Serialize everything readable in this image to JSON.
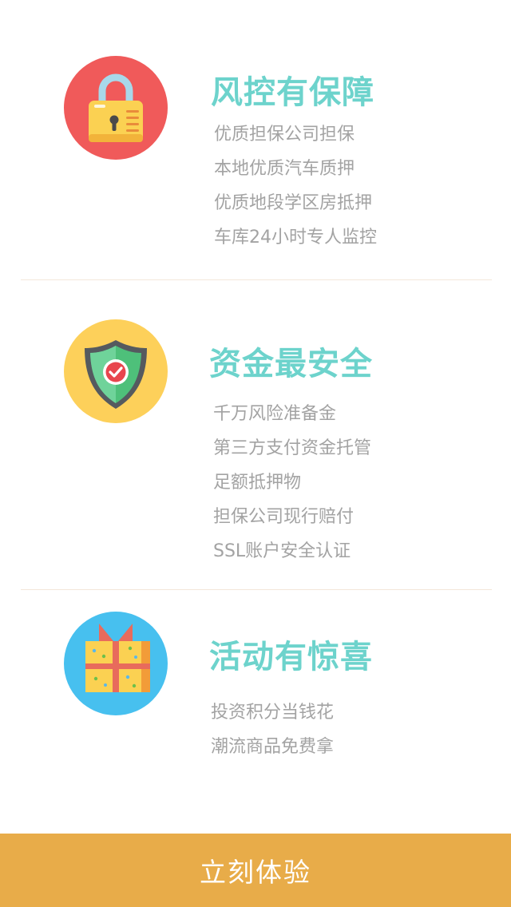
{
  "colors": {
    "title": "#6dd3cc",
    "item_text": "#a3a3a3",
    "divider": "#f3e7da",
    "cta_bg": "#e8ac49",
    "cta_text": "#ffffff"
  },
  "sections": [
    {
      "icon": "padlock-icon",
      "circle_color": "#f05a5a",
      "title": "风控有保障",
      "items": [
        "优质担保公司担保",
        "本地优质汽车质押",
        "优质地段学区房抵押",
        "车库24小时专人监控"
      ]
    },
    {
      "icon": "shield-check-icon",
      "circle_color": "#fdd05a",
      "title": "资金最安全",
      "items": [
        "千万风险准备金",
        "第三方支付资金托管",
        "足额抵押物",
        "担保公司现行赔付",
        "SSL账户安全认证"
      ]
    },
    {
      "icon": "gift-box-icon",
      "circle_color": "#47c0ef",
      "title": "活动有惊喜",
      "items": [
        "投资积分当钱花",
        "潮流商品免费拿"
      ]
    }
  ],
  "cta": {
    "label": "立刻体验"
  }
}
